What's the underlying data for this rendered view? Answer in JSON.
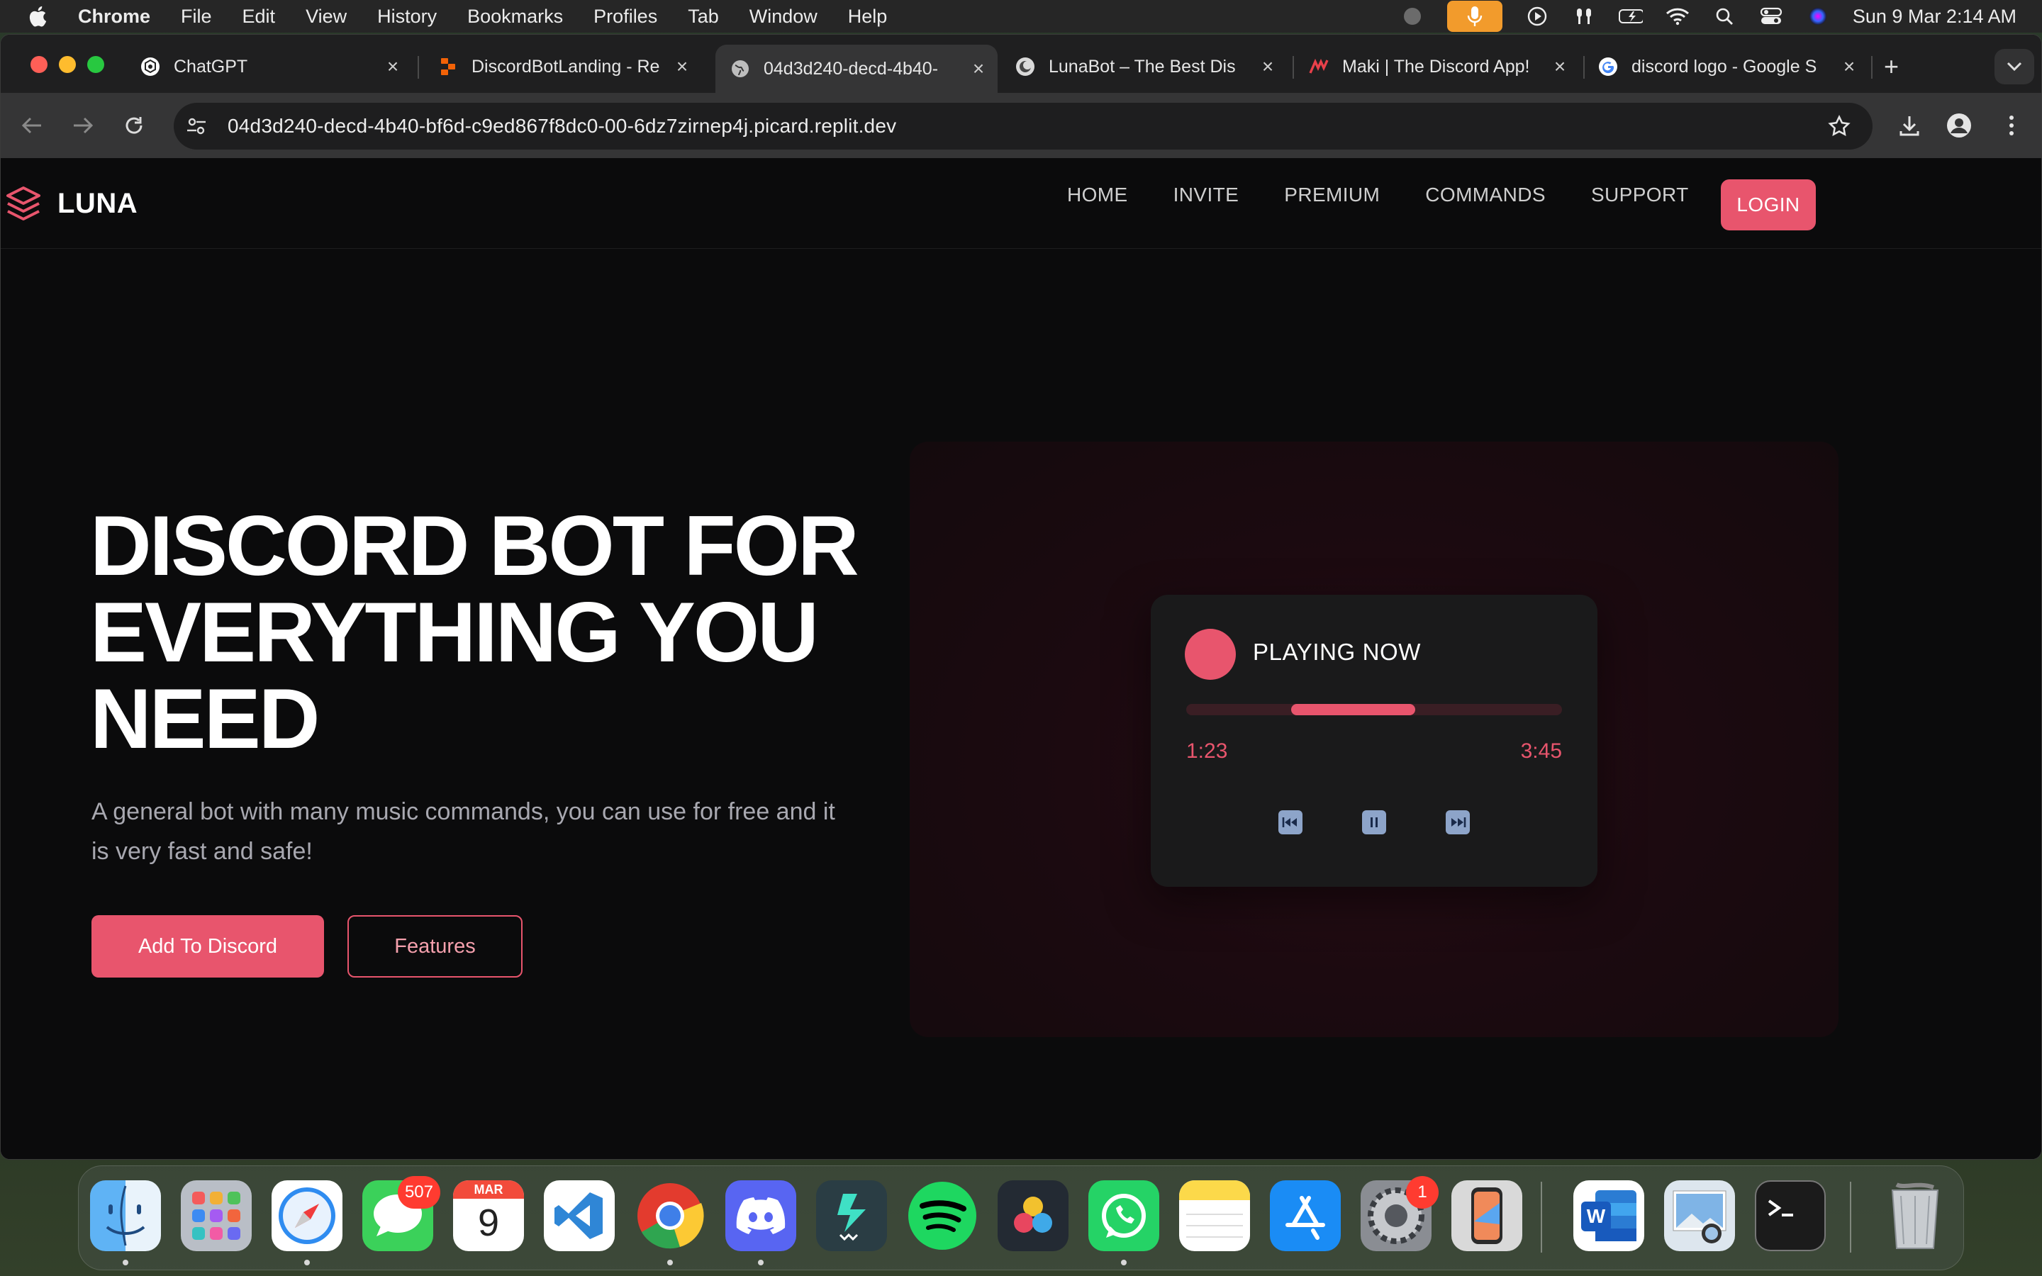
{
  "menubar": {
    "app_name": "Chrome",
    "menus": [
      "File",
      "Edit",
      "View",
      "History",
      "Bookmarks",
      "Profiles",
      "Tab",
      "Window",
      "Help"
    ],
    "clock": "Sun 9 Mar  2:14 AM"
  },
  "browser": {
    "tabs": [
      {
        "title": "ChatGPT",
        "icon": "chatgpt-icon"
      },
      {
        "title": "DiscordBotLanding - Re",
        "icon": "replit-icon"
      },
      {
        "title": "04d3d240-decd-4b40-",
        "icon": "globe-icon",
        "active": true
      },
      {
        "title": "LunaBot – The Best Dis",
        "icon": "lunabot-icon"
      },
      {
        "title": "Maki | The Discord App!",
        "icon": "maki-icon"
      },
      {
        "title": "discord logo - Google S",
        "icon": "google-icon"
      }
    ],
    "url": "04d3d240-decd-4b40-bf6d-c9ed867f8dc0-00-6dz7zirnep4j.picard.replit.dev"
  },
  "site": {
    "brand": "LUNA",
    "nav": [
      "HOME",
      "INVITE",
      "PREMIUM",
      "COMMANDS",
      "SUPPORT"
    ],
    "login": "LOGIN",
    "hero": {
      "title": "DISCORD BOT FOR EVERYTHING YOU NEED",
      "subtitle": "A general bot with many music commands, you can use for free and it is very fast and safe!",
      "primary_cta": "Add To Discord",
      "secondary_cta": "Features"
    },
    "player": {
      "label": "PLAYING NOW",
      "current_time": "1:23",
      "total_time": "3:45",
      "progress_start": 0.28,
      "progress_end": 0.61,
      "controls": [
        "previous-icon",
        "pause-icon",
        "next-icon"
      ]
    }
  },
  "dock": {
    "apps": [
      "Finder",
      "Launchpad",
      "Safari",
      "Messages",
      "Calendar",
      "Visual Studio Code",
      "Google Chrome",
      "Discord",
      "Filmora",
      "Spotify",
      "DaVinci Resolve",
      "WhatsApp",
      "Notes",
      "App Store",
      "System Settings",
      "iPhone Mirroring",
      "Microsoft Word",
      "Preview",
      "Terminal",
      "Trash"
    ],
    "messages_badge": "507",
    "settings_badge": "1",
    "calendar_month": "MAR",
    "calendar_day": "9"
  },
  "colors": {
    "accent": "#e8556d",
    "page_bg": "#0b0b0c",
    "player_bg": "#1a1a1b"
  }
}
